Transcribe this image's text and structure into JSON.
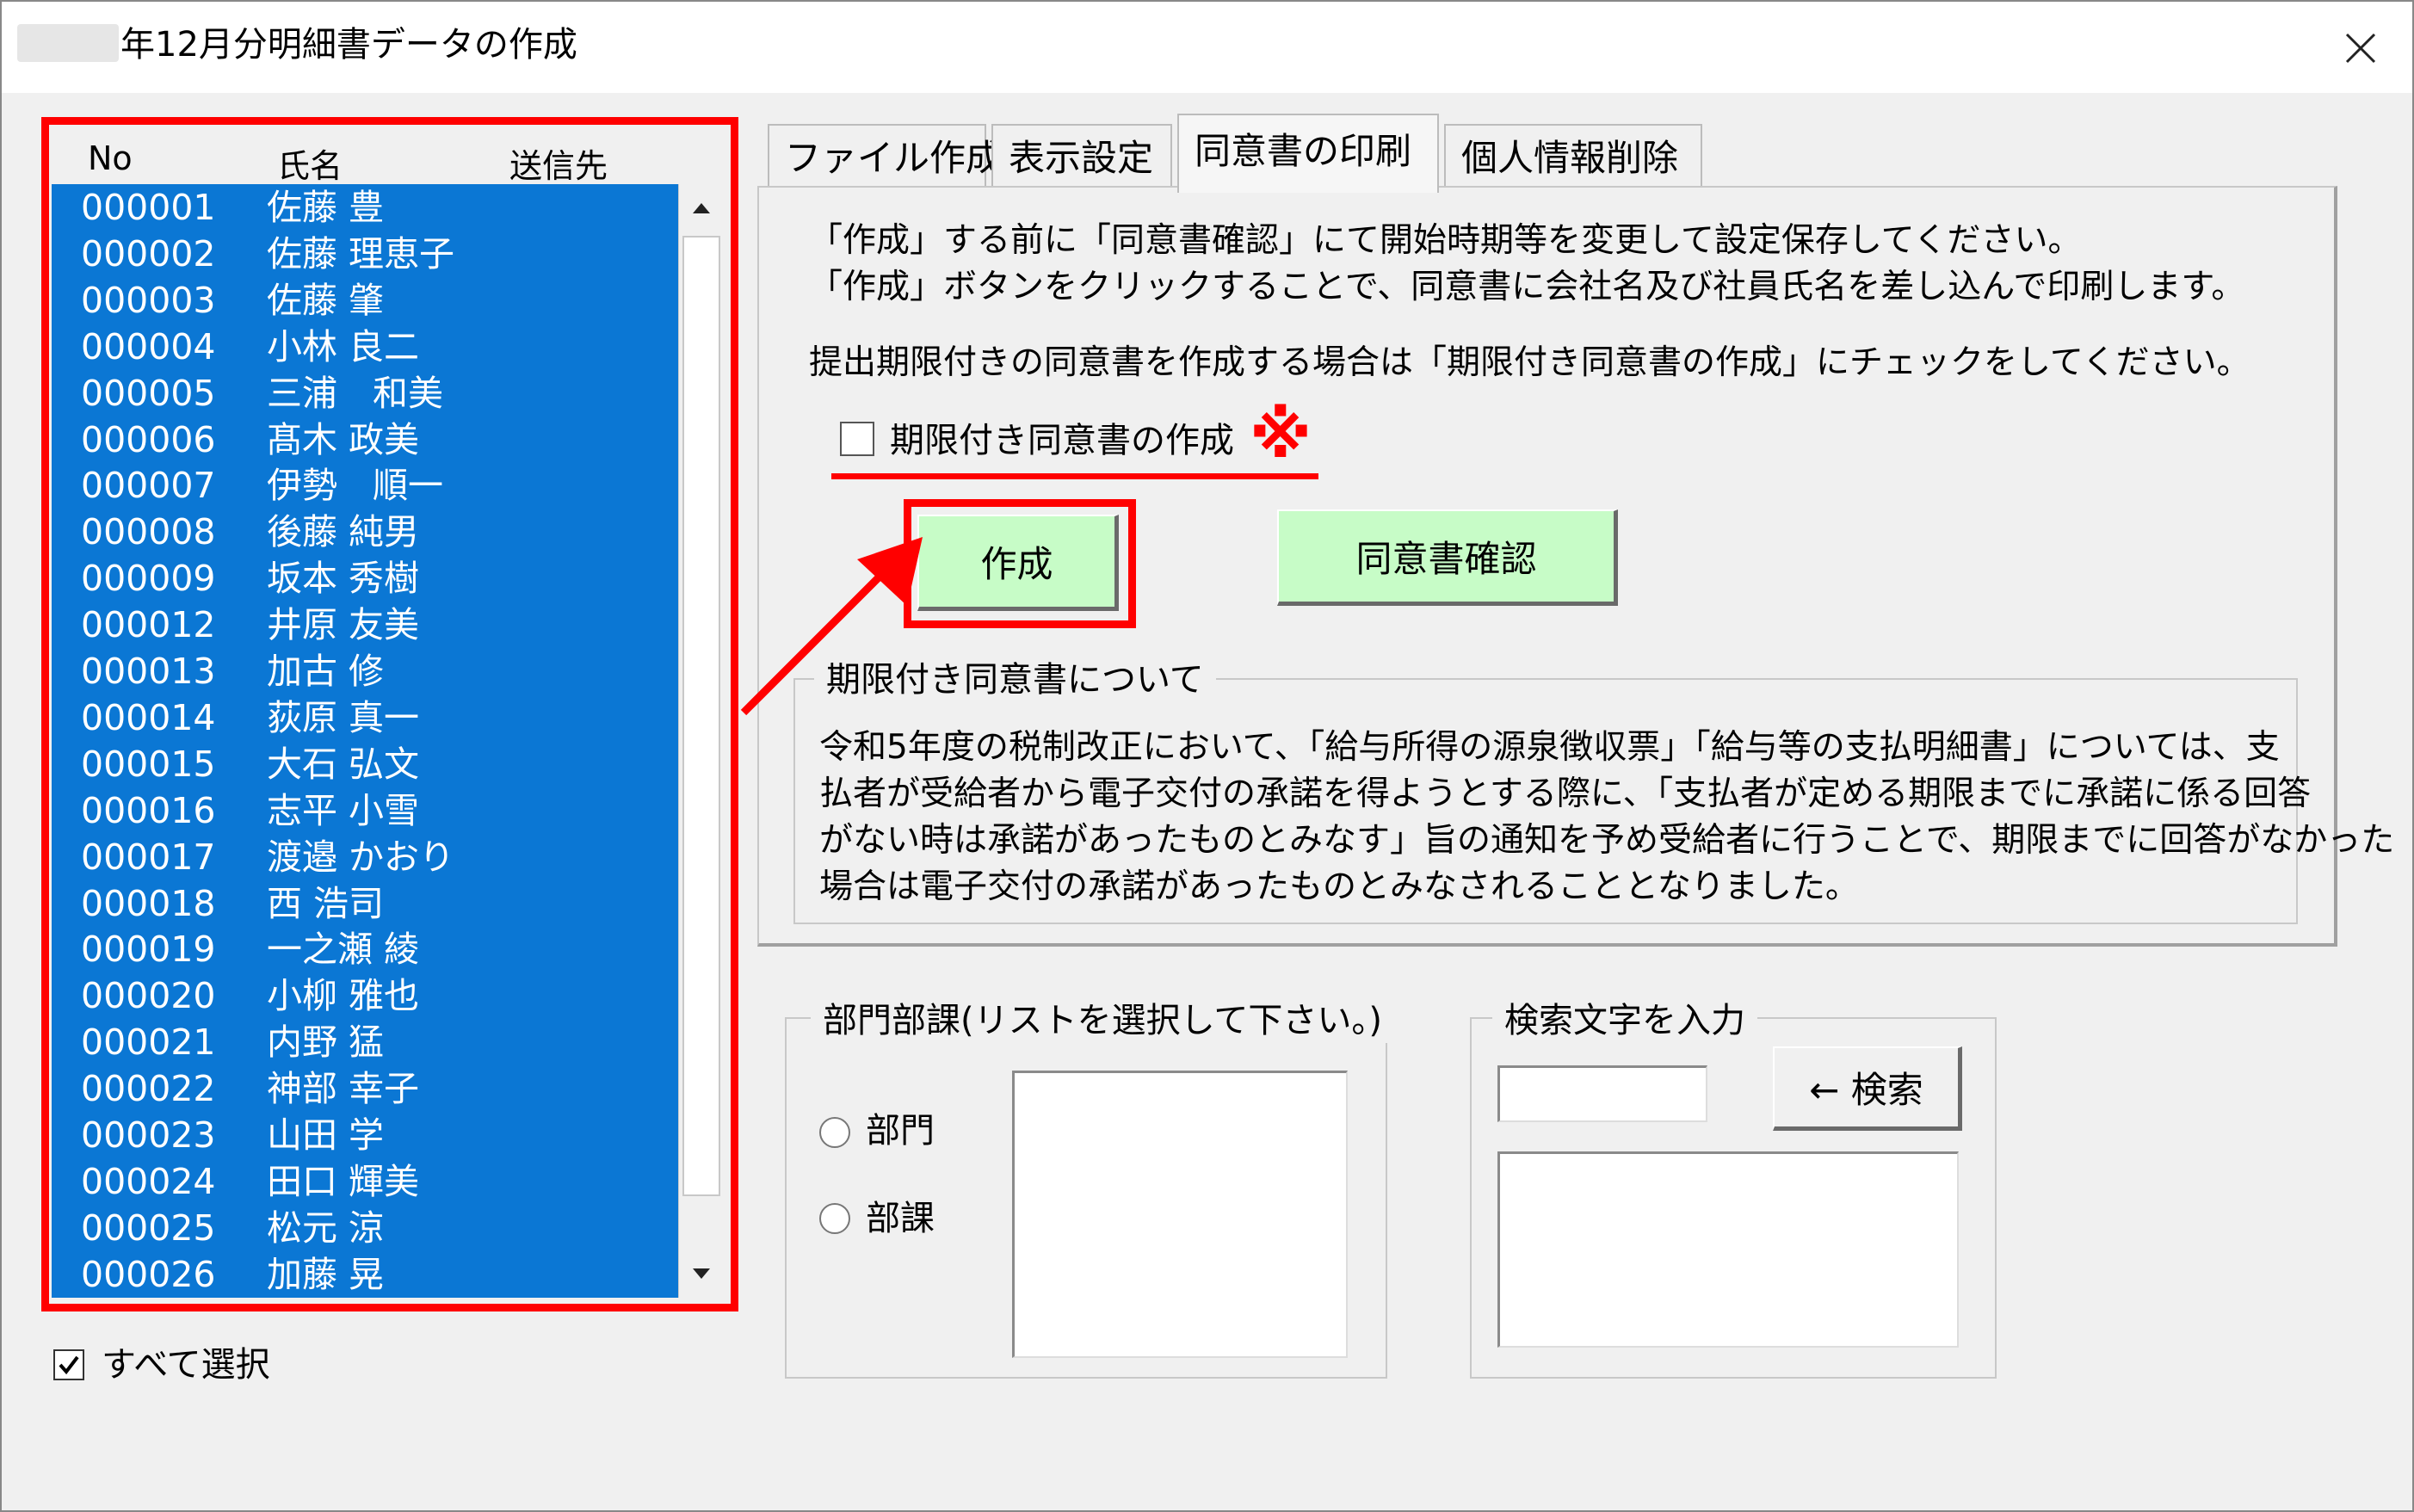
{
  "window": {
    "title": "年12月分明細書データの作成",
    "close_glyph": "✕"
  },
  "employee_list": {
    "columns": [
      "No",
      "氏名",
      "送信先"
    ],
    "rows": [
      {
        "no": "000001",
        "name": "佐藤 豊"
      },
      {
        "no": "000002",
        "name": "佐藤 理恵子"
      },
      {
        "no": "000003",
        "name": "佐藤 肇"
      },
      {
        "no": "000004",
        "name": "小林 良二"
      },
      {
        "no": "000005",
        "name": "三浦　和美"
      },
      {
        "no": "000006",
        "name": "髙木 政美"
      },
      {
        "no": "000007",
        "name": "伊勢　順一"
      },
      {
        "no": "000008",
        "name": "後藤 純男"
      },
      {
        "no": "000009",
        "name": "坂本 秀樹"
      },
      {
        "no": "000012",
        "name": "井原 友美"
      },
      {
        "no": "000013",
        "name": "加古 修"
      },
      {
        "no": "000014",
        "name": "荻原 真一"
      },
      {
        "no": "000015",
        "name": "大石 弘文"
      },
      {
        "no": "000016",
        "name": "志平 小雪"
      },
      {
        "no": "000017",
        "name": "渡邉 かおり"
      },
      {
        "no": "000018",
        "name": "西 浩司"
      },
      {
        "no": "000019",
        "name": "一之瀬 綾"
      },
      {
        "no": "000020",
        "name": "小柳 雅也"
      },
      {
        "no": "000021",
        "name": "内野 猛"
      },
      {
        "no": "000022",
        "name": "神部 幸子"
      },
      {
        "no": "000023",
        "name": "山田 学"
      },
      {
        "no": "000024",
        "name": "田口 輝美"
      },
      {
        "no": "000025",
        "name": "松元 涼"
      },
      {
        "no": "000026",
        "name": "加藤 晃"
      }
    ],
    "select_all_label": "すべて選択",
    "select_all_checked": true
  },
  "tabs": [
    {
      "label": "ファイル作成",
      "active": false
    },
    {
      "label": "表示設定",
      "active": false
    },
    {
      "label": "同意書の印刷",
      "active": true
    },
    {
      "label": "個人情報削除",
      "active": false
    }
  ],
  "print_tab": {
    "instruction_1": "「作成」する前に「同意書確認」にて開始時期等を変更して設定保存してください。",
    "instruction_2": "「作成」ボタンをクリックすることで、同意書に会社名及び社員氏名を差し込んで印刷します。",
    "instruction_3": "提出期限付きの同意書を作成する場合は「期限付き同意書の作成」にチェックをしてください。",
    "deadline_checkbox_label": "期限付き同意書の作成",
    "deadline_checked": false,
    "note_mark": "※",
    "create_button": "作成",
    "consent_check_button": "同意書確認",
    "notice_title": "期限付き同意書について",
    "notice_lines": [
      "令和5年度の税制改正において、「給与所得の源泉徴収票」「給与等の支払明細書」については、支",
      "払者が受給者から電子交付の承諾を得ようとする際に、「支払者が定める期限までに承諾に係る回答",
      "がない時は承諾があったものとみなす」旨の通知を予め受給者に行うことで、期限までに回答がなかった",
      "場合は電子交付の承諾があったものとみなされることとなりました。"
    ]
  },
  "department": {
    "legend": "部門部課(リストを選択して下さい。)",
    "radio_dept": "部門",
    "radio_section": "部課"
  },
  "search": {
    "legend": "検索文字を入力",
    "input_value": "",
    "button_label": "← 検索"
  },
  "colors": {
    "list_highlight": "#0b77d4",
    "button_green": "#c7fcc7",
    "annotation_red": "#ff0000"
  }
}
